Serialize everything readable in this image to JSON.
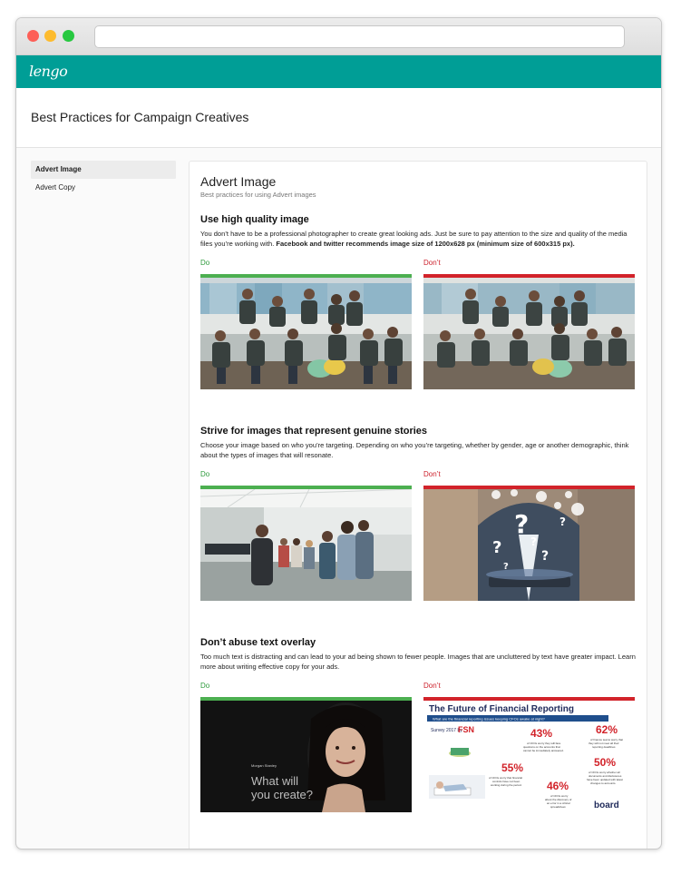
{
  "browser": {
    "url": ""
  },
  "brand": {
    "logo_text": "lengo",
    "accent_color": "#009e96"
  },
  "page": {
    "title": "Best Practices for Campaign Creatives"
  },
  "sidebar": {
    "items": [
      {
        "label": "Advert Image",
        "active": true
      },
      {
        "label": "Advert Copy",
        "active": false
      }
    ]
  },
  "main": {
    "title": "Advert Image",
    "subtitle": "Best practices for using Advert images",
    "sections": [
      {
        "heading": "Use high quality image",
        "text": "You don’t have to be a professional photographer to create great looking ads. Just be sure to pay attention to the size and quality of the media files you’re working with. ",
        "text_bold": "Facebook and twitter recommends image size of 1200x628 px (minimum size of 600x315 px).",
        "do_label": "Do",
        "dont_label": "Don’t",
        "do_image": "team-group-photo-sharp",
        "dont_image": "team-group-photo-low-quality"
      },
      {
        "heading": "Strive for images that represent genuine stories",
        "text": "Choose your image based on who you’re targeting. Depending on who you’re targeting, whether by gender, age or another demographic, think about the types of images that will resonate.",
        "do_label": "Do",
        "dont_label": "Don’t",
        "do_image": "office-team-conversation",
        "dont_image": "question-marks-tablet"
      },
      {
        "heading": "Don’t abuse text overlay",
        "text": "Too much text is distracting and can lead to your ad being shown to fewer people. Images that are uncluttered by text have greater impact. Learn more about writing effective copy for your ads.",
        "do_label": "Do",
        "dont_label": "Don’t",
        "do_image": "morgan-stanley-portrait-ad",
        "dont_image": "financial-reporting-infographic",
        "do_ad": {
          "brand": "Morgan Stanley",
          "headline_line1": "What will",
          "headline_line2": "you create?"
        },
        "dont_ad": {
          "title": "The Future of Financial Reporting",
          "banner": "What are the financial reporting issues keeping CFOs awake at night?",
          "survey": "Survey 2017 by",
          "survey_by": "FSN",
          "stat1": "43%",
          "stat1_text_a": "of CFOs worry they will face",
          "stat1_text_b": "questions on the accounts that",
          "stat1_text_c": "cannot be immediately answered.",
          "stat2": "62%",
          "stat2_text_a": "of finance teams worry that",
          "stat2_text_b": "they will not meet all their",
          "stat2_text_c": "reporting deadlines",
          "stat3": "55%",
          "stat3_text_a": "of CFOs worry that financial",
          "stat3_text_b": "controls have not been",
          "stat3_text_c": "working during the period.",
          "stat4": "50%",
          "stat4_text_a": "of CFOs worry whether all",
          "stat4_text_b": "documents and disclosures",
          "stat4_text_c": "have been updated with latest",
          "stat4_text_d": "changes to accounts.",
          "stat5": "46%",
          "stat5_text_a": "of CFOs worry",
          "stat5_text_b": "about the discovery of",
          "stat5_text_c": "an error in a critical",
          "stat5_text_d": "spreadsheet.",
          "logo": "board"
        }
      }
    ]
  }
}
